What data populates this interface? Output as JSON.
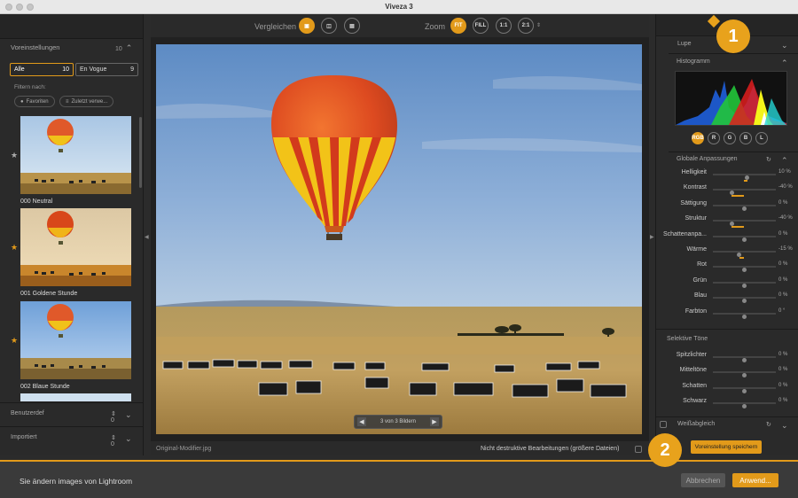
{
  "window": {
    "title": "Viveza 3"
  },
  "left_panel": {
    "presets_title": "Voreinstellungen",
    "presets_count": "10",
    "tabs": [
      {
        "label": "Alle",
        "count": "10"
      },
      {
        "label": "En Vogue",
        "count": "9"
      }
    ],
    "filter_label": "Filtern nach:",
    "filters": [
      {
        "label": "Favoriten"
      },
      {
        "label": "Zuletzt verwe..."
      }
    ],
    "presets": [
      {
        "label": "000 Neutral",
        "favorite": false
      },
      {
        "label": "001 Goldene Stunde",
        "favorite": true
      },
      {
        "label": "002 Blaue Stunde",
        "favorite": true
      }
    ],
    "custom": {
      "label": "Benutzerdef",
      "count": "0"
    },
    "imported": {
      "label": "Importiert",
      "count": "0"
    }
  },
  "toolbar": {
    "compare_label": "Vergleichen",
    "zoom_label": "Zoom",
    "zoom_options": [
      "FIT",
      "FILL",
      "1:1",
      "2:1"
    ],
    "zoom_selected": "FIT"
  },
  "preview": {
    "pager_text": "3 von 3 Bildern",
    "filename": "Original-Modifier.jpg",
    "nondestructive_label": "Nicht destruktive Bearbeitungen (größere Dateien)"
  },
  "right_panel": {
    "loupe_label": "Lupe",
    "histogram_label": "Histogramm",
    "histogram_channels": [
      "RGB",
      "R",
      "G",
      "B",
      "L"
    ],
    "histogram_selected": "RGB",
    "global_label": "Globale Anpassungen",
    "global_sliders": [
      {
        "label": "Helligkeit",
        "value": "10 %",
        "v": 10
      },
      {
        "label": "Kontrast",
        "value": "-40 %",
        "v": -40
      },
      {
        "label": "Sättigung",
        "value": "0 %",
        "v": 0
      },
      {
        "label": "Struktur",
        "value": "-40 %",
        "v": -40
      },
      {
        "label": "Schattenanpa...",
        "value": "0 %",
        "v": 0
      },
      {
        "label": "Wärme",
        "value": "-15 %",
        "v": -15
      },
      {
        "label": "Rot",
        "value": "0 %",
        "v": 0
      },
      {
        "label": "Grün",
        "value": "0 %",
        "v": 0
      },
      {
        "label": "Blau",
        "value": "0 %",
        "v": 0
      },
      {
        "label": "Farbton",
        "value": "0 °",
        "v": 0
      }
    ],
    "selective_label": "Selektive Töne",
    "selective_sliders": [
      {
        "label": "Spitzlichter",
        "value": "0 %",
        "v": 0
      },
      {
        "label": "Mitteltöne",
        "value": "0 %",
        "v": 0
      },
      {
        "label": "Schatten",
        "value": "0 %",
        "v": 0
      },
      {
        "label": "Schwarz",
        "value": "0 %",
        "v": 0
      }
    ],
    "whitebalance_label": "Weißabgleich",
    "save_preset_label": "Voreinstellung speichern"
  },
  "footer": {
    "message": "Sie ändern images von Lightroom",
    "cancel_label": "Abbrechen",
    "apply_label": "Anwend..."
  },
  "callouts": [
    "1",
    "2"
  ],
  "colors": {
    "accent": "#e29a1a",
    "badge": "#e8a21c"
  }
}
